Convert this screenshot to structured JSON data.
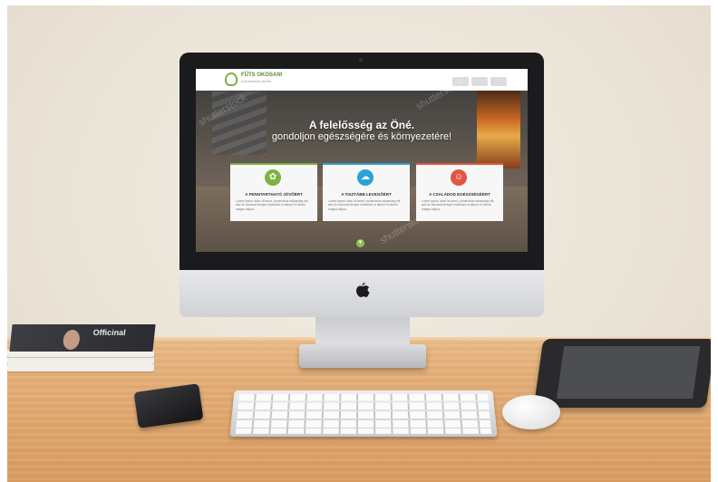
{
  "website": {
    "logo_title": "FŰTS OKOSAN!",
    "logo_subtitle": "A fenntartható jövőért",
    "hero_line1": "A felelősség az Öné.",
    "hero_line2": "gondoljon egészségére és környezetére!",
    "cards": [
      {
        "title": "A FENNTARTHATÓ JÖVŐÉRT",
        "icon": "leaf-icon",
        "color": "#7cb342",
        "text": "Lorem ipsum dolor sit amet, consectetur adipiscing elit, sed do eiusmod tempor incididunt ut labore et dolore magna aliqua."
      },
      {
        "title": "A TISZTÁBB LEVEGŐÉRT",
        "icon": "cloud-icon",
        "color": "#29a3d6",
        "text": "Lorem ipsum dolor sit amet, consectetur adipiscing elit, sed do eiusmod tempor incididunt ut labore et dolore magna aliqua."
      },
      {
        "title": "A CSALÁDOD EGÉSZSÉGÉÉRT",
        "icon": "family-icon",
        "color": "#e2553f",
        "text": "Lorem ipsum dolor sit amet, consectetur adipiscing elit, sed do eiusmod tempor incididunt ut labore et dolore magna aliqua."
      }
    ],
    "watermark": "shutterstock"
  },
  "magazine_title": "Officinal",
  "colors": {
    "accent_green": "#8bc34a",
    "desk": "#e3ad76"
  }
}
